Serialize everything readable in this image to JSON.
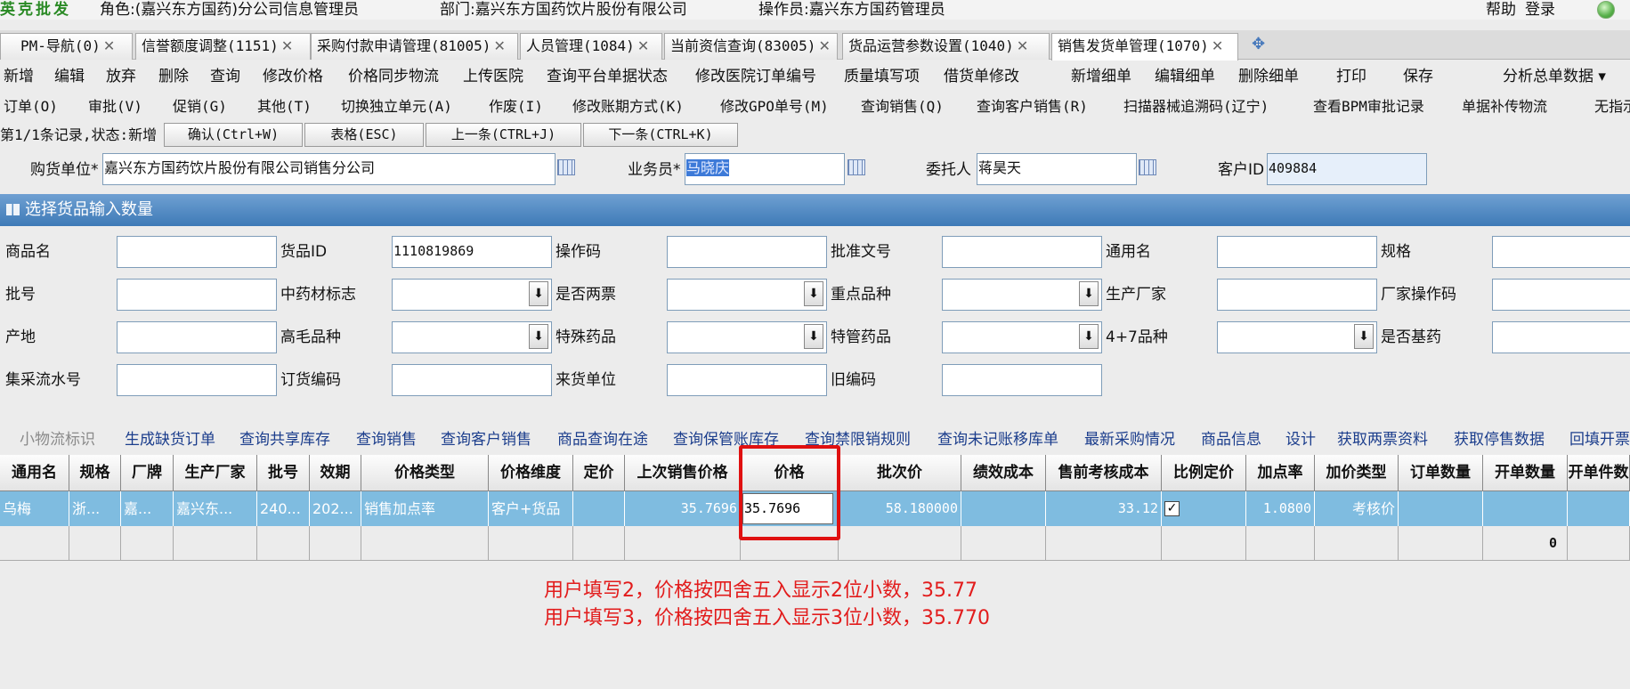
{
  "header": {
    "brand": "英克批发",
    "role": "角色:(嘉兴东方国药)分公司信息管理员",
    "dept": "部门:嘉兴东方国药饮片股份有限公司",
    "operator": "操作员:嘉兴东方国药管理员",
    "help": "帮助",
    "login": "登录"
  },
  "tabs": [
    {
      "label": "PM-导航(0)"
    },
    {
      "label": "信誉额度调整(1151)"
    },
    {
      "label": "采购付款申请管理(81005)"
    },
    {
      "label": "人员管理(1084)"
    },
    {
      "label": "当前资信查询(83005)"
    },
    {
      "label": "货品运营参数设置(1040)"
    },
    {
      "label": "销售发货单管理(1070)"
    }
  ],
  "toolbar1": [
    "新增",
    "编辑",
    "放弃",
    "删除",
    "查询",
    "修改价格",
    "价格同步物流",
    "上传医院",
    "查询平台单据状态",
    "修改医院订单编号",
    "质量填写项",
    "借货单修改",
    "新增细单",
    "编辑细单",
    "删除细单",
    "打印",
    "保存"
  ],
  "toolbar1_dropdown": "分析总单数据 ▾",
  "toolbar2": [
    "订单(O)",
    "审批(V)",
    "促销(G)",
    "其他(T)",
    "切换独立单元(A)",
    "作废(I)",
    "修改账期方式(K)",
    "修改GPO单号(M)",
    "查询销售(Q)",
    "查询客户销售(R)",
    "扫描器械追溯码(辽宁)",
    "查看BPM审批记录",
    "单据补传物流",
    "无指示"
  ],
  "record": {
    "status": "第1/1条记录,状态:新增",
    "buttons": [
      "确认(Ctrl+W)",
      "表格(ESC)",
      "上一条(CTRL+J)",
      "下一条(CTRL+K)"
    ]
  },
  "form_top": {
    "buyer_label": "购货单位*",
    "buyer_value": "嘉兴东方国药饮片股份有限公司销售分公司",
    "salesman_label": "业务员*",
    "salesman_value": "马晓庆",
    "consignor_label": "委托人",
    "consignor_value": "蒋昊天",
    "customer_id_label": "客户ID",
    "customer_id_value": "409884"
  },
  "dialog": {
    "title": "选择货品输入数量",
    "fields": {
      "product_name": {
        "label": "商品名",
        "value": ""
      },
      "goods_id": {
        "label": "货品ID",
        "value": "1110819869"
      },
      "op_code": {
        "label": "操作码",
        "value": ""
      },
      "approval_no": {
        "label": "批准文号",
        "value": ""
      },
      "common_name": {
        "label": "通用名",
        "value": ""
      },
      "spec": {
        "label": "规格",
        "value": ""
      },
      "batch_no": {
        "label": "批号",
        "value": ""
      },
      "herb_flag": {
        "label": "中药材标志",
        "value": ""
      },
      "two_invoice": {
        "label": "是否两票",
        "value": ""
      },
      "key_variety": {
        "label": "重点品种",
        "value": ""
      },
      "manufacturer": {
        "label": "生产厂家",
        "value": ""
      },
      "mfr_code": {
        "label": "厂家操作码",
        "value": ""
      },
      "origin": {
        "label": "产地",
        "value": ""
      },
      "high_margin": {
        "label": "高毛品种",
        "value": ""
      },
      "special_drug": {
        "label": "特殊药品",
        "value": ""
      },
      "special_mgmt": {
        "label": "特管药品",
        "value": ""
      },
      "four_plus_seven": {
        "label": "4+7品种",
        "value": ""
      },
      "basic_drug": {
        "label": "是否基药",
        "value": ""
      },
      "central_purchase_no": {
        "label": "集采流水号",
        "value": ""
      },
      "order_code": {
        "label": "订货编码",
        "value": ""
      },
      "supplier": {
        "label": "来货单位",
        "value": ""
      },
      "old_code": {
        "label": "旧编码",
        "value": ""
      }
    }
  },
  "links": [
    "小物流标识",
    "生成缺货订单",
    "查询共享库存",
    "查询销售",
    "查询客户销售",
    "商品查询在途",
    "查询保管账库存",
    "查询禁限销规则",
    "查询未记账移库单",
    "最新采购情况",
    "商品信息",
    "设计",
    "获取两票资料",
    "获取停售数据",
    "回填开票"
  ],
  "grid": {
    "columns": [
      "通用名",
      "规格",
      "厂牌",
      "生产厂家",
      "批号",
      "效期",
      "价格类型",
      "价格维度",
      "定价",
      "上次销售价格",
      "价格",
      "批次价",
      "绩效成本",
      "售前考核成本",
      "比例定价",
      "加点率",
      "加价类型",
      "订单数量",
      "开单数量",
      "开单件数"
    ],
    "row": [
      "乌梅",
      "浙...",
      "嘉...",
      "嘉兴东...",
      "240...",
      "202...",
      "销售加点率",
      "客户+货品",
      "",
      "35.7696",
      "35.7696",
      "58.180000",
      "",
      "33.12",
      "✓",
      "1.0800",
      "考核价",
      "",
      "",
      ""
    ],
    "total_qty": "0"
  },
  "notes": [
    "用户填写2，价格按四舍五入显示2位小数，35.77",
    "用户填写3，价格按四舍五入显示3位小数，35.770"
  ]
}
